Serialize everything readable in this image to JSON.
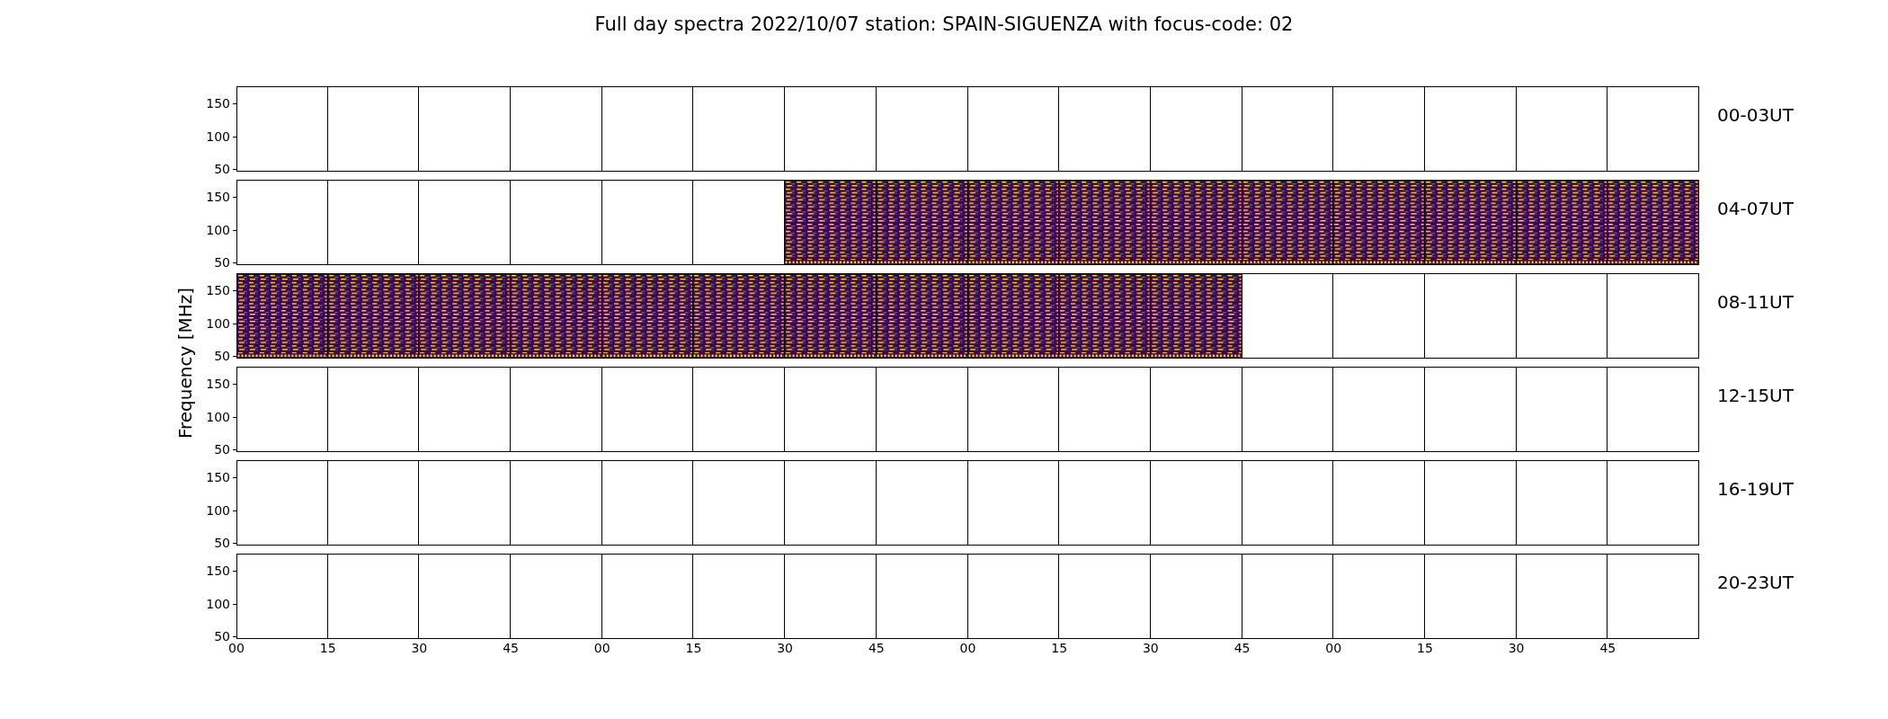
{
  "title": "Full day spectra 2022/10/07 station: SPAIN-SIGUENZA with focus-code: 02",
  "ylabel": "Frequency [MHz]",
  "rows": [
    {
      "label": "00-03UT",
      "yticks": [
        "150",
        "100",
        "50"
      ],
      "panels": [
        {
          "filled": false
        },
        {
          "filled": false
        },
        {
          "filled": false
        },
        {
          "filled": false
        },
        {
          "filled": false
        },
        {
          "filled": false
        },
        {
          "filled": false
        },
        {
          "filled": false
        },
        {
          "filled": false
        },
        {
          "filled": false
        },
        {
          "filled": false
        },
        {
          "filled": false
        },
        {
          "filled": false
        },
        {
          "filled": false
        },
        {
          "filled": false
        },
        {
          "filled": false
        }
      ]
    },
    {
      "label": "04-07UT",
      "yticks": [
        "150",
        "100",
        "50"
      ],
      "panels": [
        {
          "filled": false
        },
        {
          "filled": false
        },
        {
          "filled": false
        },
        {
          "filled": false
        },
        {
          "filled": false
        },
        {
          "filled": false
        },
        {
          "filled": true
        },
        {
          "filled": true
        },
        {
          "filled": true
        },
        {
          "filled": true
        },
        {
          "filled": true
        },
        {
          "filled": true
        },
        {
          "filled": true
        },
        {
          "filled": true
        },
        {
          "filled": true
        },
        {
          "filled": true
        }
      ]
    },
    {
      "label": "08-11UT",
      "yticks": [
        "150",
        "100",
        "50"
      ],
      "panels": [
        {
          "filled": true
        },
        {
          "filled": true
        },
        {
          "filled": true
        },
        {
          "filled": true
        },
        {
          "filled": true
        },
        {
          "filled": true
        },
        {
          "filled": true
        },
        {
          "filled": true
        },
        {
          "filled": true
        },
        {
          "filled": true
        },
        {
          "filled": true
        },
        {
          "filled": false
        },
        {
          "filled": false
        },
        {
          "filled": false
        },
        {
          "filled": false
        },
        {
          "filled": false
        }
      ]
    },
    {
      "label": "12-15UT",
      "yticks": [
        "150",
        "100",
        "50"
      ],
      "panels": [
        {
          "filled": false
        },
        {
          "filled": false
        },
        {
          "filled": false
        },
        {
          "filled": false
        },
        {
          "filled": false
        },
        {
          "filled": false
        },
        {
          "filled": false
        },
        {
          "filled": false
        },
        {
          "filled": false
        },
        {
          "filled": false
        },
        {
          "filled": false
        },
        {
          "filled": false
        },
        {
          "filled": false
        },
        {
          "filled": false
        },
        {
          "filled": false
        },
        {
          "filled": false
        }
      ]
    },
    {
      "label": "16-19UT",
      "yticks": [
        "150",
        "100",
        "50"
      ],
      "panels": [
        {
          "filled": false
        },
        {
          "filled": false
        },
        {
          "filled": false
        },
        {
          "filled": false
        },
        {
          "filled": false
        },
        {
          "filled": false
        },
        {
          "filled": false
        },
        {
          "filled": false
        },
        {
          "filled": false
        },
        {
          "filled": false
        },
        {
          "filled": false
        },
        {
          "filled": false
        },
        {
          "filled": false
        },
        {
          "filled": false
        },
        {
          "filled": false
        },
        {
          "filled": false
        }
      ]
    },
    {
      "label": "20-23UT",
      "yticks": [
        "150",
        "100",
        "50"
      ],
      "panels": [
        {
          "filled": false
        },
        {
          "filled": false
        },
        {
          "filled": false
        },
        {
          "filled": false
        },
        {
          "filled": false
        },
        {
          "filled": false
        },
        {
          "filled": false
        },
        {
          "filled": false
        },
        {
          "filled": false
        },
        {
          "filled": false
        },
        {
          "filled": false
        },
        {
          "filled": false
        },
        {
          "filled": false
        },
        {
          "filled": false
        },
        {
          "filled": false
        },
        {
          "filled": false
        }
      ]
    }
  ],
  "xticks": [
    "00",
    "15",
    "30",
    "45",
    "00",
    "15",
    "30",
    "45",
    "00",
    "15",
    "30",
    "45",
    "00",
    "15",
    "30",
    "45"
  ]
}
